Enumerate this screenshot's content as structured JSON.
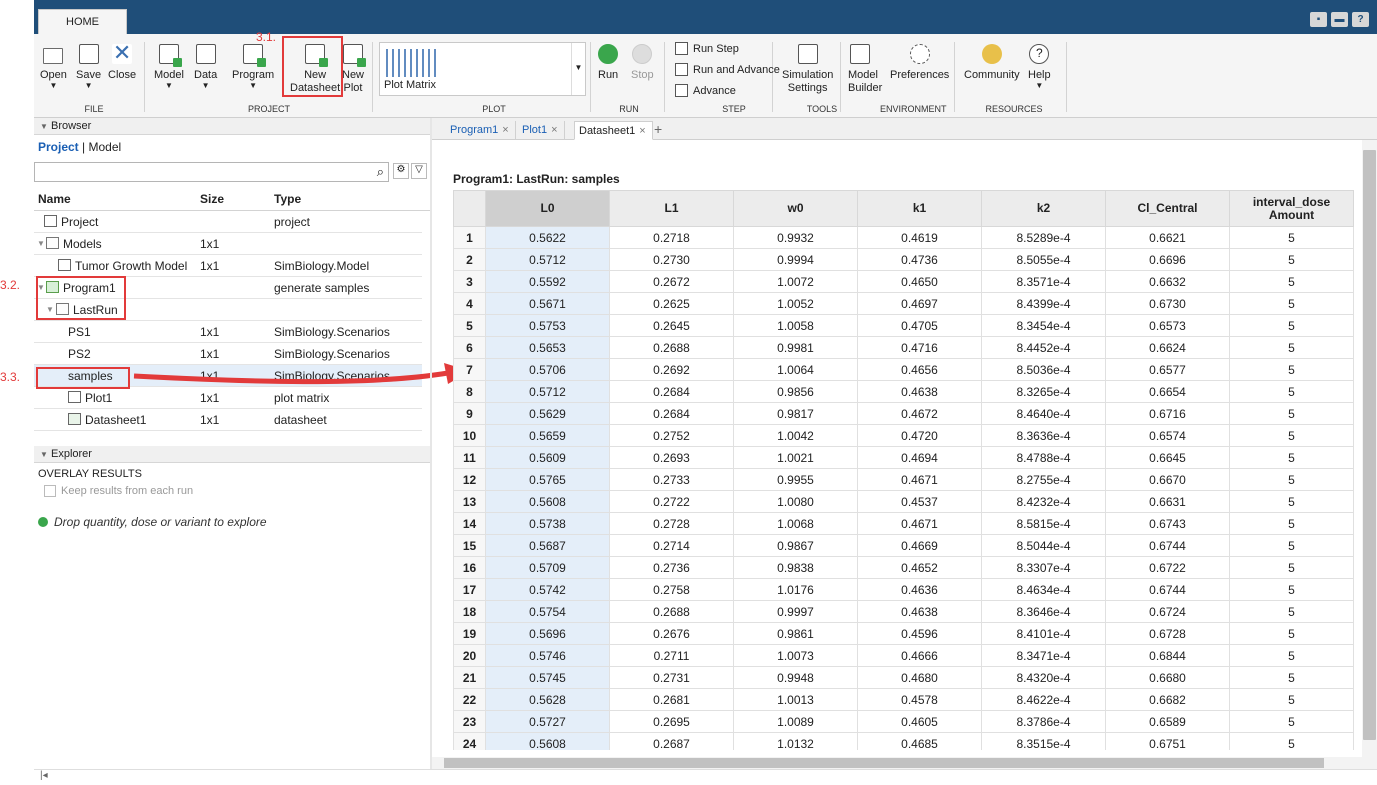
{
  "window": {
    "home_tab": "HOME"
  },
  "ribbon": {
    "file": {
      "open": "Open",
      "save": "Save",
      "close": "Close",
      "group": "FILE"
    },
    "project": {
      "model": "Model",
      "data": "Data",
      "program": "Program",
      "new_datasheet_1": "New",
      "new_datasheet_2": "Datasheet",
      "new_plot_1": "New",
      "new_plot_2": "Plot",
      "group": "PROJECT"
    },
    "plot": {
      "gallery_item": "Plot Matrix",
      "group": "PLOT"
    },
    "run": {
      "run": "Run",
      "stop": "Stop",
      "group": "RUN"
    },
    "step": {
      "run_step": "Run Step",
      "run_and_advance": "Run and Advance",
      "advance": "Advance",
      "group": "STEP"
    },
    "tools": {
      "sim_settings_1": "Simulation",
      "sim_settings_2": "Settings",
      "group": "TOOLS"
    },
    "environment": {
      "model_builder_1": "Model",
      "model_builder_2": "Builder",
      "preferences": "Preferences",
      "group": "ENVIRONMENT"
    },
    "resources": {
      "community": "Community",
      "help": "Help",
      "group": "RESOURCES"
    }
  },
  "annotations": {
    "a1": "3.1.",
    "a2": "3.2.",
    "a3": "3.3."
  },
  "browser": {
    "title": "Browser",
    "project_link": "Project",
    "model_link": "Model",
    "separator": "|",
    "columns": {
      "name": "Name",
      "size": "Size",
      "type": "Type"
    },
    "rows": [
      {
        "name": "Project",
        "size": "",
        "type": "project"
      },
      {
        "name": "Models",
        "size": "1x1",
        "type": ""
      },
      {
        "name": "Tumor Growth Model",
        "size": "1x1",
        "type": "SimBiology.Model"
      },
      {
        "name": "Program1",
        "size": "",
        "type": "generate samples"
      },
      {
        "name": "LastRun",
        "size": "",
        "type": ""
      },
      {
        "name": "PS1",
        "size": "1x1",
        "type": "SimBiology.Scenarios"
      },
      {
        "name": "PS2",
        "size": "1x1",
        "type": "SimBiology.Scenarios"
      },
      {
        "name": "samples",
        "size": "1x1",
        "type": "SimBiology.Scenarios"
      },
      {
        "name": "Plot1",
        "size": "1x1",
        "type": "plot matrix"
      },
      {
        "name": "Datasheet1",
        "size": "1x1",
        "type": "datasheet"
      }
    ]
  },
  "explorer": {
    "title": "Explorer",
    "overlay": "OVERLAY RESULTS",
    "keep": "Keep results from each run",
    "drop": "Drop quantity, dose or variant to explore"
  },
  "doc_tabs": {
    "program1": "Program1",
    "plot1": "Plot1",
    "datasheet1": "Datasheet1",
    "close": "×",
    "add": "+"
  },
  "datasheet": {
    "title": "Program1: LastRun: samples",
    "columns": [
      "L0",
      "L1",
      "w0",
      "k1",
      "k2",
      "Cl_Central",
      "interval_dose Amount"
    ],
    "rows": [
      [
        "1",
        "0.5622",
        "0.2718",
        "0.9932",
        "0.4619",
        "8.5289e-4",
        "0.6621",
        "5"
      ],
      [
        "2",
        "0.5712",
        "0.2730",
        "0.9994",
        "0.4736",
        "8.5055e-4",
        "0.6696",
        "5"
      ],
      [
        "3",
        "0.5592",
        "0.2672",
        "1.0072",
        "0.4650",
        "8.3571e-4",
        "0.6632",
        "5"
      ],
      [
        "4",
        "0.5671",
        "0.2625",
        "1.0052",
        "0.4697",
        "8.4399e-4",
        "0.6730",
        "5"
      ],
      [
        "5",
        "0.5753",
        "0.2645",
        "1.0058",
        "0.4705",
        "8.3454e-4",
        "0.6573",
        "5"
      ],
      [
        "6",
        "0.5653",
        "0.2688",
        "0.9981",
        "0.4716",
        "8.4452e-4",
        "0.6624",
        "5"
      ],
      [
        "7",
        "0.5706",
        "0.2692",
        "1.0064",
        "0.4656",
        "8.5036e-4",
        "0.6577",
        "5"
      ],
      [
        "8",
        "0.5712",
        "0.2684",
        "0.9856",
        "0.4638",
        "8.3265e-4",
        "0.6654",
        "5"
      ],
      [
        "9",
        "0.5629",
        "0.2684",
        "0.9817",
        "0.4672",
        "8.4640e-4",
        "0.6716",
        "5"
      ],
      [
        "10",
        "0.5659",
        "0.2752",
        "1.0042",
        "0.4720",
        "8.3636e-4",
        "0.6574",
        "5"
      ],
      [
        "11",
        "0.5609",
        "0.2693",
        "1.0021",
        "0.4694",
        "8.4788e-4",
        "0.6645",
        "5"
      ],
      [
        "12",
        "0.5765",
        "0.2733",
        "0.9955",
        "0.4671",
        "8.2755e-4",
        "0.6670",
        "5"
      ],
      [
        "13",
        "0.5608",
        "0.2722",
        "1.0080",
        "0.4537",
        "8.4232e-4",
        "0.6631",
        "5"
      ],
      [
        "14",
        "0.5738",
        "0.2728",
        "1.0068",
        "0.4671",
        "8.5815e-4",
        "0.6743",
        "5"
      ],
      [
        "15",
        "0.5687",
        "0.2714",
        "0.9867",
        "0.4669",
        "8.5044e-4",
        "0.6744",
        "5"
      ],
      [
        "16",
        "0.5709",
        "0.2736",
        "0.9838",
        "0.4652",
        "8.3307e-4",
        "0.6722",
        "5"
      ],
      [
        "17",
        "0.5742",
        "0.2758",
        "1.0176",
        "0.4636",
        "8.4634e-4",
        "0.6744",
        "5"
      ],
      [
        "18",
        "0.5754",
        "0.2688",
        "0.9997",
        "0.4638",
        "8.3646e-4",
        "0.6724",
        "5"
      ],
      [
        "19",
        "0.5696",
        "0.2676",
        "0.9861",
        "0.4596",
        "8.4101e-4",
        "0.6728",
        "5"
      ],
      [
        "20",
        "0.5746",
        "0.2711",
        "1.0073",
        "0.4666",
        "8.3471e-4",
        "0.6844",
        "5"
      ],
      [
        "21",
        "0.5745",
        "0.2731",
        "0.9948",
        "0.4680",
        "8.4320e-4",
        "0.6680",
        "5"
      ],
      [
        "22",
        "0.5628",
        "0.2681",
        "1.0013",
        "0.4578",
        "8.4622e-4",
        "0.6682",
        "5"
      ],
      [
        "23",
        "0.5727",
        "0.2695",
        "1.0089",
        "0.4605",
        "8.3786e-4",
        "0.6589",
        "5"
      ],
      [
        "24",
        "0.5608",
        "0.2687",
        "1.0132",
        "0.4685",
        "8.3515e-4",
        "0.6751",
        "5"
      ]
    ]
  },
  "colors": {
    "accent": "#1f4e79",
    "highlight": "#e23a3a",
    "selection": "#e4eef9"
  }
}
